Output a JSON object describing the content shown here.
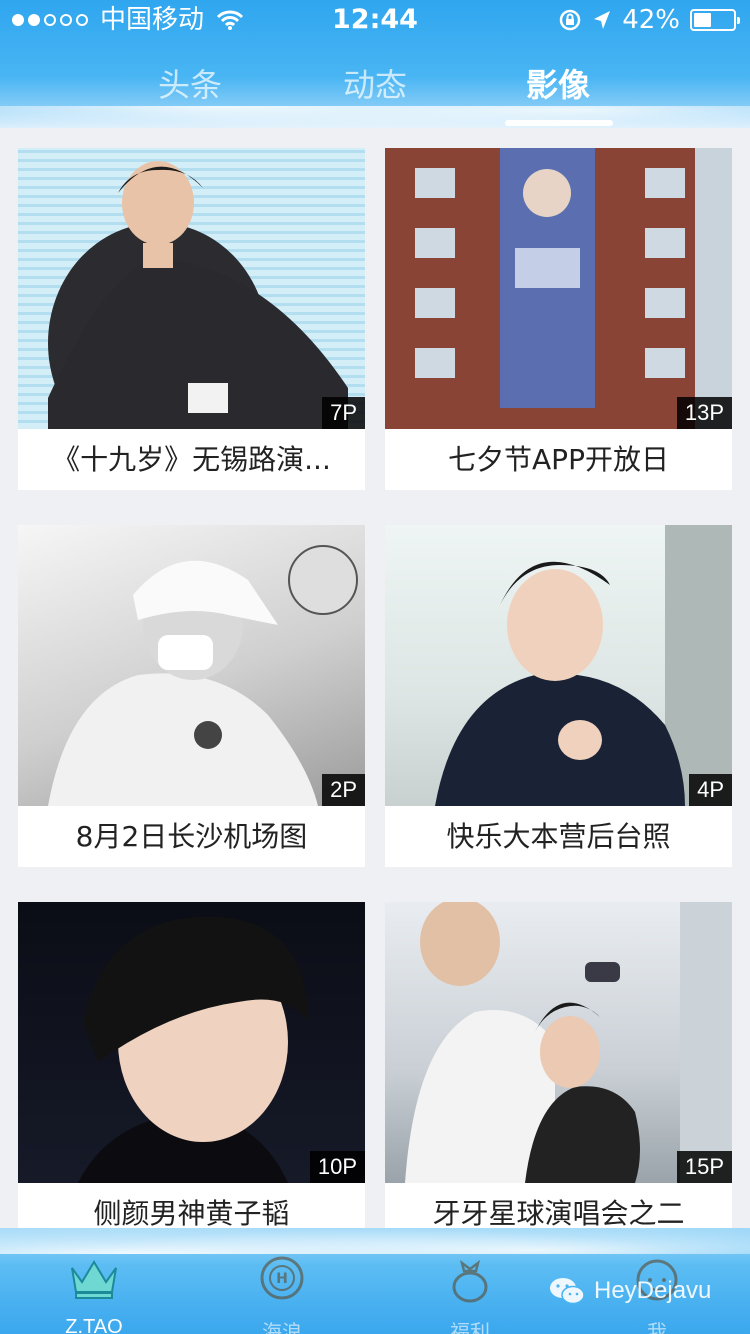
{
  "status": {
    "carrier": "中国移动",
    "time": "12:44",
    "battery": "42%",
    "battery_level": 0.42,
    "signal_bars_filled": 2,
    "signal_bars_total": 5
  },
  "tabs": [
    {
      "label": "头条",
      "active": false
    },
    {
      "label": "动态",
      "active": false
    },
    {
      "label": "影像",
      "active": true
    }
  ],
  "albums": [
    {
      "title": "《十九岁》无锡路演...",
      "count": "7P"
    },
    {
      "title": "七夕节APP开放日",
      "count": "13P"
    },
    {
      "title": "8月2日长沙机场图",
      "count": "2P"
    },
    {
      "title": "快乐大本营后台照",
      "count": "4P"
    },
    {
      "title": "侧颜男神黄子韬",
      "count": "10P"
    },
    {
      "title": "牙牙星球演唱会之二",
      "count": "15P"
    }
  ],
  "bottom_nav": [
    {
      "label": "Z.TAO",
      "icon": "crown-icon",
      "active": true
    },
    {
      "label": "海浪",
      "icon": "planet-h-icon",
      "active": false
    },
    {
      "label": "福利",
      "icon": "gift-bag-icon",
      "active": false
    },
    {
      "label": "我",
      "icon": "face-icon",
      "active": false
    }
  ],
  "watermark": "HeyDejavu",
  "colors": {
    "accent": "#2fa6ef",
    "badge_bg": "#000000"
  }
}
